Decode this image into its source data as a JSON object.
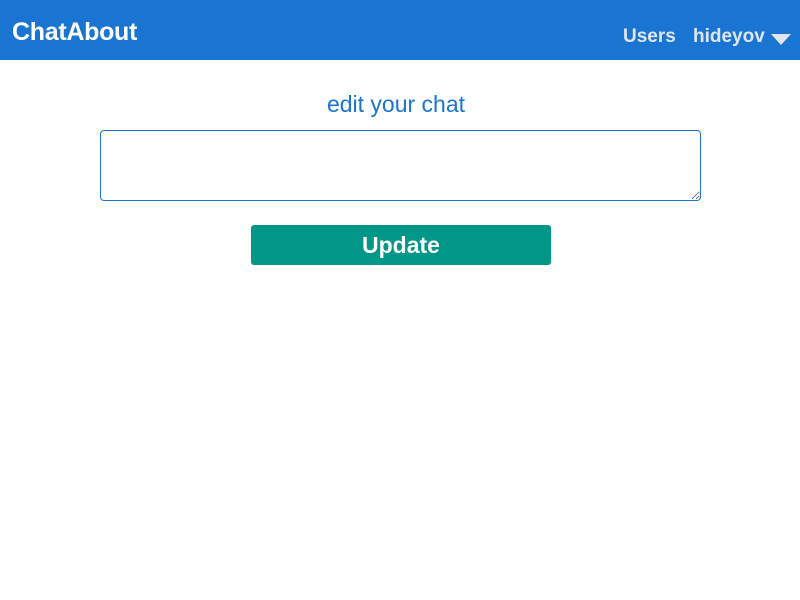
{
  "header": {
    "brand": "ChatAbout",
    "nav_users": "Users",
    "username": "hideyov",
    "menu_icon": "caret-down-icon",
    "background_color": "#1a75d2"
  },
  "main": {
    "heading": "edit your chat",
    "chat_input": {
      "value": "",
      "placeholder": ""
    },
    "update_button": {
      "label": "Update",
      "color": "#009688"
    }
  }
}
